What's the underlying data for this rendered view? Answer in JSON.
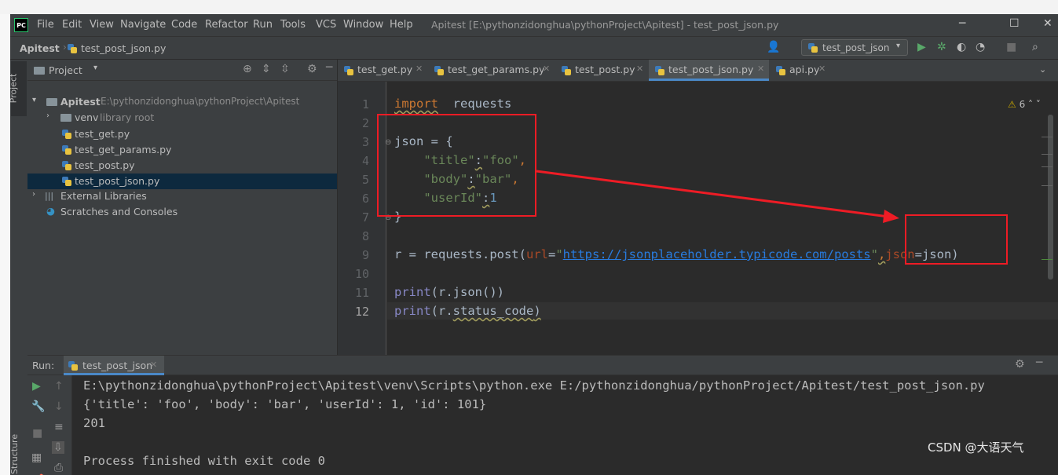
{
  "menu": [
    "File",
    "Edit",
    "View",
    "Navigate",
    "Code",
    "Refactor",
    "Run",
    "Tools",
    "VCS",
    "Window",
    "Help"
  ],
  "window_title": "Apitest [E:\\pythonzidonghua\\pythonProject\\Apitest] - test_post_json.py",
  "breadcrumb": {
    "project": "Apitest",
    "file": "test_post_json.py"
  },
  "run_config": "test_post_json",
  "stripes": {
    "project": "Project",
    "structure": "Structure"
  },
  "project_panel": {
    "title": "Project",
    "root": {
      "name": "Apitest",
      "path": "E:\\pythonzidonghua\\pythonProject\\Apitest"
    },
    "venv": {
      "name": "venv",
      "note": "library root"
    },
    "files": [
      "test_get.py",
      "test_get_params.py",
      "test_post.py",
      "test_post_json.py"
    ],
    "external": "External Libraries",
    "scratches": "Scratches and Consoles"
  },
  "tabs": [
    "test_get.py",
    "test_get_params.py",
    "test_post.py",
    "test_post_json.py",
    "api.py"
  ],
  "active_tab": "test_post_json.py",
  "editor": {
    "line_numbers": [
      "1",
      "2",
      "3",
      "4",
      "5",
      "6",
      "7",
      "8",
      "9",
      "10",
      "11",
      "12"
    ],
    "warning_count": "6",
    "code": {
      "l1": {
        "kw": "import",
        "rest": "requests"
      },
      "l3": "json = {",
      "l4": {
        "key": "\"title\"",
        "val": "\"foo\""
      },
      "l5": {
        "key": "\"body\"",
        "val": "\"bar\""
      },
      "l6": {
        "key": "\"userId\"",
        "val": "1"
      },
      "l7": "}",
      "l9": {
        "a": "r = requests.post(",
        "p1": "url",
        "url": "https://jsonplaceholder.typicode.com/posts",
        "p2": "json",
        "tail": "=json)"
      },
      "l11": {
        "fn": "print",
        "rest": "(r.json())"
      },
      "l12": {
        "fn": "print",
        "pre": "(r.",
        "field": "status_code",
        "tail": ")"
      }
    }
  },
  "run_panel": {
    "label": "Run:",
    "tab": "test_post_json",
    "output": [
      "E:\\pythonzidonghua\\pythonProject\\Apitest\\venv\\Scripts\\python.exe E:/pythonzidonghua/pythonProject/Apitest/test_post_json.py",
      "{'title': 'foo', 'body': 'bar', 'userId': 1, 'id': 101}",
      "201",
      "",
      "Process finished with exit code 0"
    ]
  },
  "watermark": "CSDN @大语天气",
  "colors": {
    "annotation": "#ee1c25",
    "selection": "#0d293e",
    "keyword": "#cc7832",
    "string": "#6a8759"
  }
}
